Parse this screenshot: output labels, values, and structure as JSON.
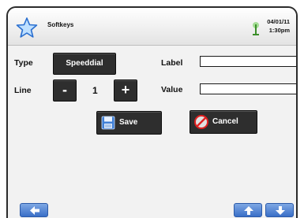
{
  "header": {
    "title": "Softkeys",
    "app_icon": "star-icon",
    "status_icon": "signal-antenna-icon",
    "date": "04/01/11",
    "time": "1:30pm"
  },
  "form": {
    "type_label": "Type",
    "type_value": "Speeddial",
    "line_label": "Line",
    "line_minus": "-",
    "line_value": "1",
    "line_plus": "+",
    "label_label": "Label",
    "label_value": "",
    "value_label": "Value",
    "value_value": ""
  },
  "actions": {
    "save": "Save",
    "save_icon": "save-disk-icon",
    "cancel": "Cancel",
    "cancel_icon": "cancel-icon"
  },
  "footer": {
    "back_icon": "arrow-left-icon",
    "up_icon": "arrow-up-icon",
    "down_icon": "arrow-down-icon"
  },
  "colors": {
    "button_dark": "#2e2e2e",
    "nav_blue": "#3a6fc8",
    "background": "#f2f2f2"
  }
}
